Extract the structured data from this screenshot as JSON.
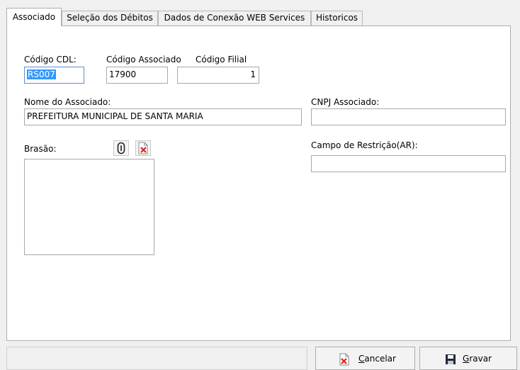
{
  "tabs": [
    {
      "label": "Associado"
    },
    {
      "label": "Seleção dos Débitos"
    },
    {
      "label": "Dados de Conexão WEB Services"
    },
    {
      "label": "Historicos"
    }
  ],
  "form": {
    "codigo_cdl": {
      "label": "Código CDL:",
      "value": "RS007"
    },
    "codigo_associado": {
      "label": "Código Associado",
      "value": "17900"
    },
    "codigo_filial": {
      "label": "Código Filial",
      "value": "1"
    },
    "nome_associado": {
      "label": "Nome do Associado:",
      "value": "PREFEITURA MUNICIPAL DE SANTA MARIA"
    },
    "cnpj_associado": {
      "label": "CNPJ Associado:",
      "value": ""
    },
    "brasao": {
      "label": "Brasão:"
    },
    "campo_restricao": {
      "label": "Campo de Restrição(AR):",
      "value": ""
    }
  },
  "buttons": {
    "cancel": {
      "mnemonic": "C",
      "rest": "ancelar"
    },
    "save": {
      "mnemonic": "G",
      "rest": "ravar"
    }
  },
  "icons": {
    "attach": "paperclip-icon",
    "remove_image": "delete-image-icon",
    "cancel": "cancel-icon",
    "save": "floppy-disk-icon"
  },
  "colors": {
    "selection": "#3399ff",
    "focus_border": "#5a8ed1",
    "danger": "#e02020"
  }
}
